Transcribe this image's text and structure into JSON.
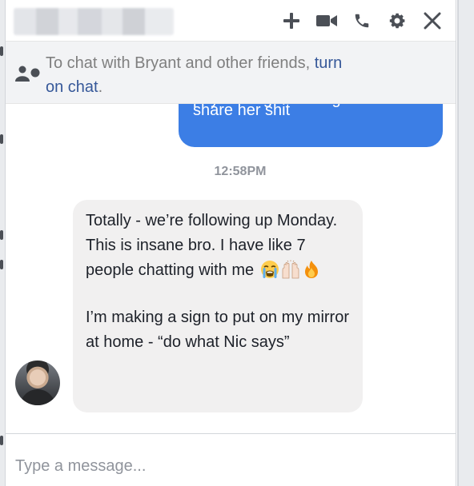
{
  "header": {
    "contact_name": "",
    "icons": [
      "plus-icon",
      "video-camera-icon",
      "phone-icon",
      "gear-icon",
      "close-icon"
    ],
    "icon_color": "#4b4f56"
  },
  "notice": {
    "icon": "people-icon",
    "text": "To chat with Bryant and other friends, ",
    "link_text": "turn on chat",
    "suffix": "."
  },
  "messages": {
    "outgoing": {
      "clipped_line": "payo and gets rolling. I'll",
      "line": "share her shit",
      "color": "#3c7ee5"
    },
    "timestamp": "12:58PM",
    "incoming": {
      "paragraph_1": "Totally - we’re following up Monday. This is insane bro. I have like 7 people chatting with me",
      "emojis": [
        "loudly-crying-face-icon",
        "raising-hands-icon",
        "fire-icon"
      ],
      "paragraph_2": "I’m making a sign to put on my mirror at home - “do what Nic says”",
      "avatar": "avatar"
    }
  },
  "composer": {
    "placeholder": "Type a message..."
  }
}
